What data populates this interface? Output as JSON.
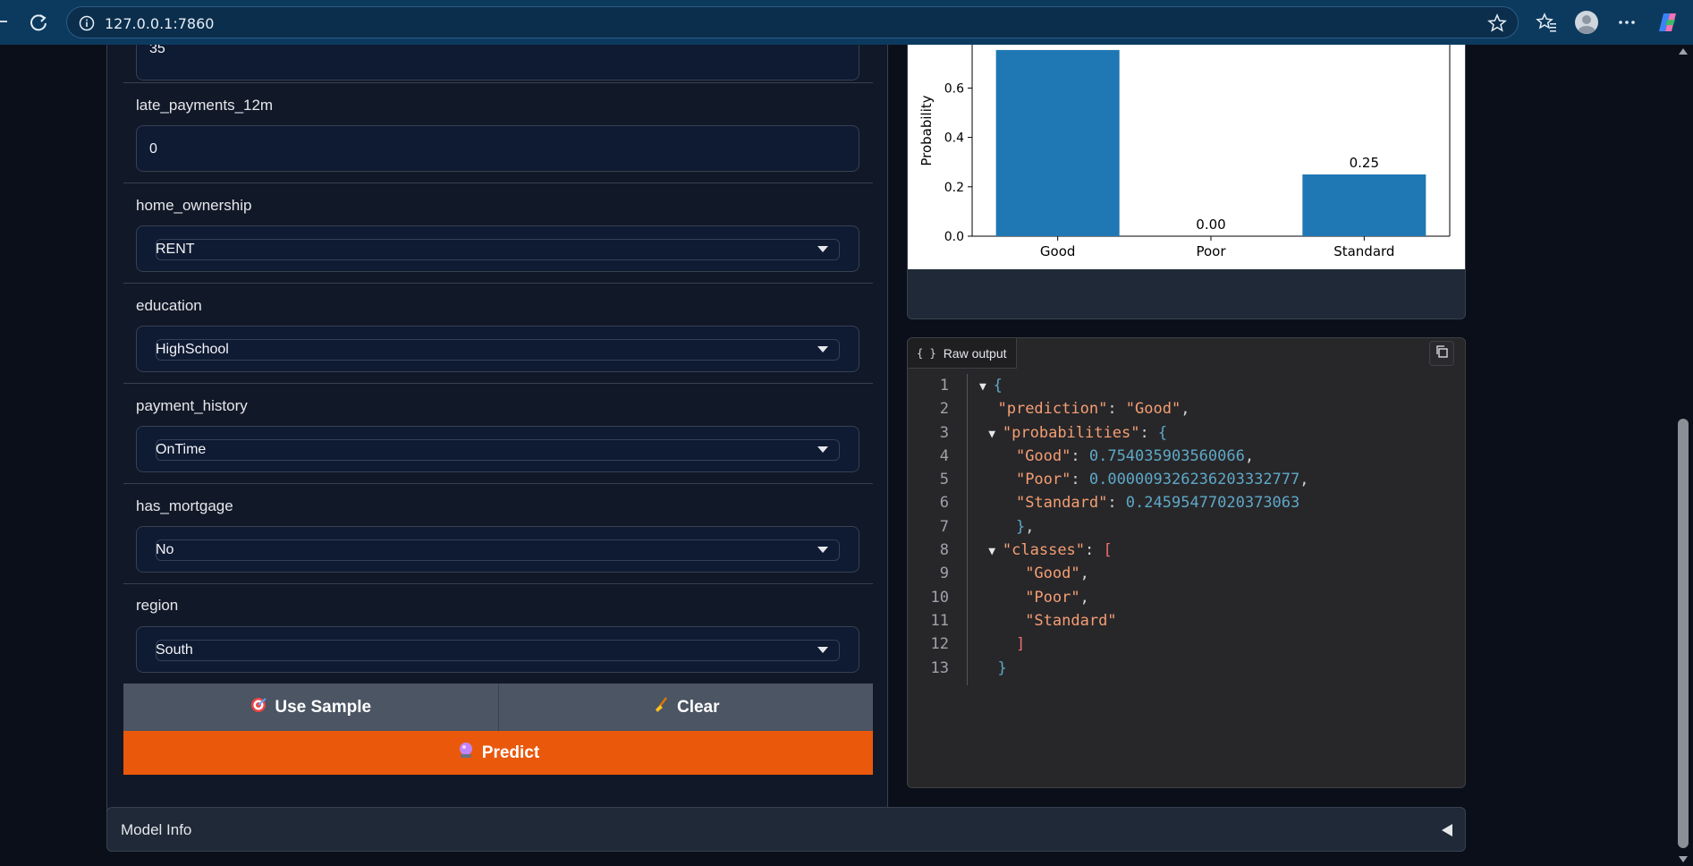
{
  "browser": {
    "url": "127.0.0.1:7860"
  },
  "form": {
    "top_partial_value": "35",
    "fields": [
      {
        "label": "late_payments_12m",
        "value": "0",
        "kind": "number"
      },
      {
        "label": "home_ownership",
        "value": "RENT",
        "kind": "dropdown"
      },
      {
        "label": "education",
        "value": "HighSchool",
        "kind": "dropdown"
      },
      {
        "label": "payment_history",
        "value": "OnTime",
        "kind": "dropdown"
      },
      {
        "label": "has_mortgage",
        "value": "No",
        "kind": "dropdown"
      },
      {
        "label": "region",
        "value": "South",
        "kind": "dropdown"
      }
    ],
    "use_sample_label": "Use Sample",
    "clear_label": "Clear",
    "predict_label": "Predict"
  },
  "chart_data": {
    "type": "bar",
    "categories": [
      "Good",
      "Poor",
      "Standard"
    ],
    "values": [
      0.754,
      0.0,
      0.25
    ],
    "data_labels": [
      "",
      "0.00",
      "0.25"
    ],
    "ylabel": "Probability",
    "yticks": [
      "0.0",
      "0.2",
      "0.4",
      "0.6"
    ],
    "ylim": [
      0,
      1
    ],
    "bar_color": "#1f77b4"
  },
  "raw_output": {
    "title": "Raw output",
    "lines": [
      {
        "n": "1",
        "tokens": [
          [
            "tri",
            "▼ "
          ],
          [
            "b",
            "{"
          ]
        ]
      },
      {
        "n": "2",
        "tokens": [
          [
            "p",
            "  "
          ],
          [
            "k",
            "\"prediction\""
          ],
          [
            "p",
            ": "
          ],
          [
            "s",
            "\"Good\""
          ],
          [
            "p",
            ","
          ]
        ]
      },
      {
        "n": "3",
        "tokens": [
          [
            "p",
            " "
          ],
          [
            "tri",
            "▼ "
          ],
          [
            "k",
            "\"probabilities\""
          ],
          [
            "p",
            ": "
          ],
          [
            "b",
            "{"
          ]
        ]
      },
      {
        "n": "4",
        "tokens": [
          [
            "p",
            "    "
          ],
          [
            "k",
            "\"Good\""
          ],
          [
            "p",
            ": "
          ],
          [
            "n",
            "0.754035903560066"
          ],
          [
            "p",
            ","
          ]
        ]
      },
      {
        "n": "5",
        "tokens": [
          [
            "p",
            "    "
          ],
          [
            "k",
            "\"Poor\""
          ],
          [
            "p",
            ": "
          ],
          [
            "n",
            "0.000009326236203332777"
          ],
          [
            "p",
            ","
          ]
        ]
      },
      {
        "n": "6",
        "tokens": [
          [
            "p",
            "    "
          ],
          [
            "k",
            "\"Standard\""
          ],
          [
            "p",
            ": "
          ],
          [
            "n",
            "0.24595477020373063"
          ]
        ]
      },
      {
        "n": "7",
        "tokens": [
          [
            "p",
            "    "
          ],
          [
            "b",
            "}"
          ],
          [
            "p",
            ","
          ]
        ]
      },
      {
        "n": "8",
        "tokens": [
          [
            "p",
            " "
          ],
          [
            "tri",
            "▼ "
          ],
          [
            "k",
            "\"classes\""
          ],
          [
            "p",
            ": "
          ],
          [
            "br",
            "["
          ]
        ]
      },
      {
        "n": "9",
        "tokens": [
          [
            "p",
            "     "
          ],
          [
            "s",
            "\"Good\""
          ],
          [
            "p",
            ","
          ]
        ]
      },
      {
        "n": "10",
        "tokens": [
          [
            "p",
            "     "
          ],
          [
            "s",
            "\"Poor\""
          ],
          [
            "p",
            ","
          ]
        ]
      },
      {
        "n": "11",
        "tokens": [
          [
            "p",
            "     "
          ],
          [
            "s",
            "\"Standard\""
          ]
        ]
      },
      {
        "n": "12",
        "tokens": [
          [
            "p",
            "    "
          ],
          [
            "br",
            "]"
          ]
        ]
      },
      {
        "n": "13",
        "tokens": [
          [
            "p",
            "  "
          ],
          [
            "b",
            "}"
          ]
        ]
      }
    ]
  },
  "model_info": {
    "label": "Model Info"
  }
}
